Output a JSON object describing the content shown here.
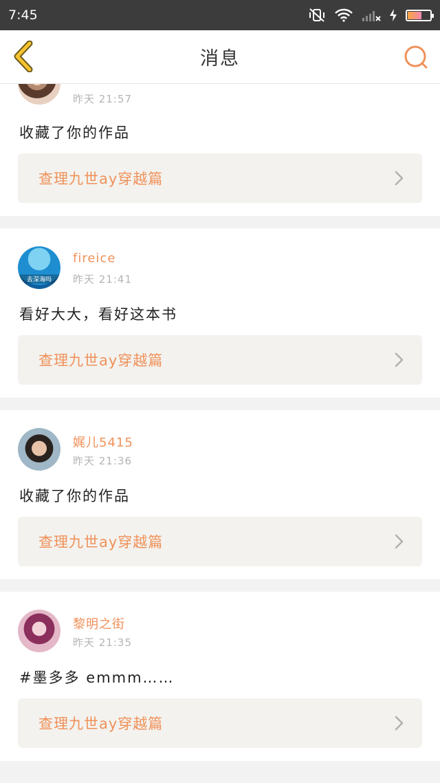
{
  "status_bar": {
    "time": "7:45"
  },
  "header": {
    "title": "消息"
  },
  "colors": {
    "accent": "#f0915a",
    "back_arrow": "#f6c22f",
    "divider": "#f2f2f2",
    "work_bg": "#f3f2ee"
  },
  "messages": [
    {
      "user": "",
      "time": "昨天 21:57",
      "text": "收藏了你的作品",
      "work": "查理九世ay穿越篇"
    },
    {
      "user": "fireice",
      "time": "昨天 21:41",
      "text": "看好大大，看好这本书",
      "work": "查理九世ay穿越篇",
      "avatar_caption": "去深海吗"
    },
    {
      "user": "娓儿5415",
      "time": "昨天 21:36",
      "text": "收藏了你的作品",
      "work": "查理九世ay穿越篇"
    },
    {
      "user": "黎明之街",
      "time": "昨天 21:35",
      "text": "#墨多多 emmm……",
      "work": "查理九世ay穿越篇"
    }
  ]
}
